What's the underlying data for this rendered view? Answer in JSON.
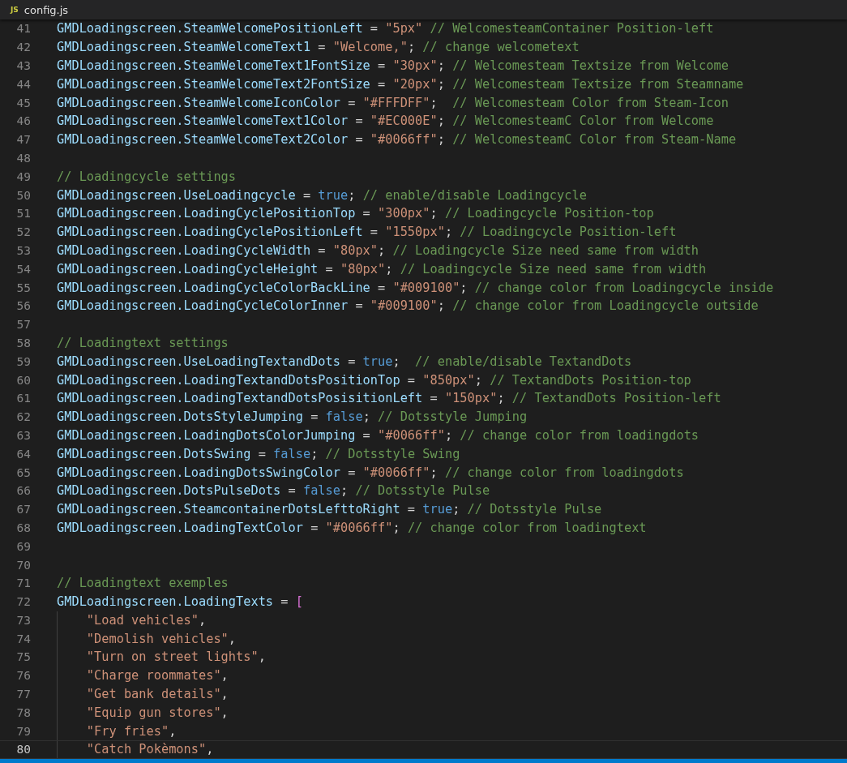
{
  "tab": {
    "icon_text": "JS",
    "title": "config.js"
  },
  "lines": [
    {
      "number": "41",
      "current": false,
      "indent": false,
      "tokens": [
        {
          "kind": "id",
          "text": "GMDLoadingscreen.SteamWelcomePositionLeft"
        },
        {
          "kind": "op",
          "text": " = "
        },
        {
          "kind": "str",
          "text": "\"5px\""
        },
        {
          "kind": "cm",
          "text": " // WelcomesteamContainer Position-left"
        }
      ]
    },
    {
      "number": "42",
      "current": false,
      "indent": false,
      "tokens": [
        {
          "kind": "id",
          "text": "GMDLoadingscreen.SteamWelcomeText1"
        },
        {
          "kind": "op",
          "text": " = "
        },
        {
          "kind": "str",
          "text": "\"Welcome,\""
        },
        {
          "kind": "op",
          "text": "; "
        },
        {
          "kind": "cm",
          "text": "// change welcometext"
        }
      ]
    },
    {
      "number": "43",
      "current": false,
      "indent": false,
      "tokens": [
        {
          "kind": "id",
          "text": "GMDLoadingscreen.SteamWelcomeText1FontSize"
        },
        {
          "kind": "op",
          "text": " = "
        },
        {
          "kind": "str",
          "text": "\"30px\""
        },
        {
          "kind": "op",
          "text": "; "
        },
        {
          "kind": "cm",
          "text": "// Welcomesteam Textsize from Welcome"
        }
      ]
    },
    {
      "number": "44",
      "current": false,
      "indent": false,
      "tokens": [
        {
          "kind": "id",
          "text": "GMDLoadingscreen.SteamWelcomeText2FontSize"
        },
        {
          "kind": "op",
          "text": " = "
        },
        {
          "kind": "str",
          "text": "\"20px\""
        },
        {
          "kind": "op",
          "text": "; "
        },
        {
          "kind": "cm",
          "text": "// Welcomesteam Textsize from Steamname"
        }
      ]
    },
    {
      "number": "45",
      "current": false,
      "indent": false,
      "tokens": [
        {
          "kind": "id",
          "text": "GMDLoadingscreen.SteamWelcomeIconColor"
        },
        {
          "kind": "op",
          "text": " = "
        },
        {
          "kind": "str",
          "text": "\"#FFFDFF\""
        },
        {
          "kind": "op",
          "text": ";  "
        },
        {
          "kind": "cm",
          "text": "// Welcomesteam Color from Steam-Icon"
        }
      ]
    },
    {
      "number": "46",
      "current": false,
      "indent": false,
      "tokens": [
        {
          "kind": "id",
          "text": "GMDLoadingscreen.SteamWelcomeText1Color"
        },
        {
          "kind": "op",
          "text": " = "
        },
        {
          "kind": "str",
          "text": "\"#EC000E\""
        },
        {
          "kind": "op",
          "text": "; "
        },
        {
          "kind": "cm",
          "text": "// WelcomesteamC Color from Welcome"
        }
      ]
    },
    {
      "number": "47",
      "current": false,
      "indent": false,
      "tokens": [
        {
          "kind": "id",
          "text": "GMDLoadingscreen.SteamWelcomeText2Color"
        },
        {
          "kind": "op",
          "text": " = "
        },
        {
          "kind": "str",
          "text": "\"#0066ff\""
        },
        {
          "kind": "op",
          "text": "; "
        },
        {
          "kind": "cm",
          "text": "// WelcomesteamC Color from Steam-Name"
        }
      ]
    },
    {
      "number": "48",
      "current": false,
      "indent": false
    },
    {
      "number": "49",
      "current": false,
      "indent": false,
      "tokens": [
        {
          "kind": "cm",
          "text": "// Loadingcycle settings"
        }
      ]
    },
    {
      "number": "50",
      "current": false,
      "indent": false,
      "tokens": [
        {
          "kind": "id",
          "text": "GMDLoadingscreen.UseLoadingcycle"
        },
        {
          "kind": "op",
          "text": " = "
        },
        {
          "kind": "kw",
          "text": "true"
        },
        {
          "kind": "op",
          "text": "; "
        },
        {
          "kind": "cm",
          "text": "// enable/disable Loadingcycle"
        }
      ]
    },
    {
      "number": "51",
      "current": false,
      "indent": false,
      "tokens": [
        {
          "kind": "id",
          "text": "GMDLoadingscreen.LoadingCyclePositionTop"
        },
        {
          "kind": "op",
          "text": " = "
        },
        {
          "kind": "str",
          "text": "\"300px\""
        },
        {
          "kind": "op",
          "text": "; "
        },
        {
          "kind": "cm",
          "text": "// Loadingcycle Position-top"
        }
      ]
    },
    {
      "number": "52",
      "current": false,
      "indent": false,
      "tokens": [
        {
          "kind": "id",
          "text": "GMDLoadingscreen.LoadingCyclePositionLeft"
        },
        {
          "kind": "op",
          "text": " = "
        },
        {
          "kind": "str",
          "text": "\"1550px\""
        },
        {
          "kind": "op",
          "text": "; "
        },
        {
          "kind": "cm",
          "text": "// Loadingcycle Position-left"
        }
      ]
    },
    {
      "number": "53",
      "current": false,
      "indent": false,
      "tokens": [
        {
          "kind": "id",
          "text": "GMDLoadingscreen.LoadingCycleWidth"
        },
        {
          "kind": "op",
          "text": " = "
        },
        {
          "kind": "str",
          "text": "\"80px\""
        },
        {
          "kind": "op",
          "text": "; "
        },
        {
          "kind": "cm",
          "text": "// Loadingcycle Size need same from width"
        }
      ]
    },
    {
      "number": "54",
      "current": false,
      "indent": false,
      "tokens": [
        {
          "kind": "id",
          "text": "GMDLoadingscreen.LoadingCycleHeight"
        },
        {
          "kind": "op",
          "text": " = "
        },
        {
          "kind": "str",
          "text": "\"80px\""
        },
        {
          "kind": "op",
          "text": "; "
        },
        {
          "kind": "cm",
          "text": "// Loadingcycle Size need same from width"
        }
      ]
    },
    {
      "number": "55",
      "current": false,
      "indent": false,
      "tokens": [
        {
          "kind": "id",
          "text": "GMDLoadingscreen.LoadingCycleColorBackLine"
        },
        {
          "kind": "op",
          "text": " = "
        },
        {
          "kind": "str",
          "text": "\"#009100\""
        },
        {
          "kind": "op",
          "text": "; "
        },
        {
          "kind": "cm",
          "text": "// change color from Loadingcycle inside"
        }
      ]
    },
    {
      "number": "56",
      "current": false,
      "indent": false,
      "tokens": [
        {
          "kind": "id",
          "text": "GMDLoadingscreen.LoadingCycleColorInner"
        },
        {
          "kind": "op",
          "text": " = "
        },
        {
          "kind": "str",
          "text": "\"#009100\""
        },
        {
          "kind": "op",
          "text": "; "
        },
        {
          "kind": "cm",
          "text": "// change color from Loadingcycle outside"
        }
      ]
    },
    {
      "number": "57",
      "current": false,
      "indent": false
    },
    {
      "number": "58",
      "current": false,
      "indent": false,
      "tokens": [
        {
          "kind": "cm",
          "text": "// Loadingtext settings"
        }
      ]
    },
    {
      "number": "59",
      "current": false,
      "indent": false,
      "tokens": [
        {
          "kind": "id",
          "text": "GMDLoadingscreen.UseLoadingTextandDots"
        },
        {
          "kind": "op",
          "text": " = "
        },
        {
          "kind": "kw",
          "text": "true"
        },
        {
          "kind": "op",
          "text": ";  "
        },
        {
          "kind": "cm",
          "text": "// enable/disable TextandDots"
        }
      ]
    },
    {
      "number": "60",
      "current": false,
      "indent": false,
      "tokens": [
        {
          "kind": "id",
          "text": "GMDLoadingscreen.LoadingTextandDotsPositionTop"
        },
        {
          "kind": "op",
          "text": " = "
        },
        {
          "kind": "str",
          "text": "\"850px\""
        },
        {
          "kind": "op",
          "text": "; "
        },
        {
          "kind": "cm",
          "text": "// TextandDots Position-top"
        }
      ]
    },
    {
      "number": "61",
      "current": false,
      "indent": false,
      "tokens": [
        {
          "kind": "id",
          "text": "GMDLoadingscreen.LoadingTextandDotsPosisitionLeft"
        },
        {
          "kind": "op",
          "text": " = "
        },
        {
          "kind": "str",
          "text": "\"150px\""
        },
        {
          "kind": "op",
          "text": "; "
        },
        {
          "kind": "cm",
          "text": "// TextandDots Position-left"
        }
      ]
    },
    {
      "number": "62",
      "current": false,
      "indent": false,
      "tokens": [
        {
          "kind": "id",
          "text": "GMDLoadingscreen.DotsStyleJumping"
        },
        {
          "kind": "op",
          "text": " = "
        },
        {
          "kind": "kw",
          "text": "false"
        },
        {
          "kind": "op",
          "text": "; "
        },
        {
          "kind": "cm",
          "text": "// Dotsstyle Jumping"
        }
      ]
    },
    {
      "number": "63",
      "current": false,
      "indent": false,
      "tokens": [
        {
          "kind": "id",
          "text": "GMDLoadingscreen.LoadingDotsColorJumping"
        },
        {
          "kind": "op",
          "text": " = "
        },
        {
          "kind": "str",
          "text": "\"#0066ff\""
        },
        {
          "kind": "op",
          "text": "; "
        },
        {
          "kind": "cm",
          "text": "// change color from loadingdots"
        }
      ]
    },
    {
      "number": "64",
      "current": false,
      "indent": false,
      "tokens": [
        {
          "kind": "id",
          "text": "GMDLoadingscreen.DotsSwing"
        },
        {
          "kind": "op",
          "text": " = "
        },
        {
          "kind": "kw",
          "text": "false"
        },
        {
          "kind": "op",
          "text": "; "
        },
        {
          "kind": "cm",
          "text": "// Dotsstyle Swing"
        }
      ]
    },
    {
      "number": "65",
      "current": false,
      "indent": false,
      "tokens": [
        {
          "kind": "id",
          "text": "GMDLoadingscreen.LoadingDotsSwingColor"
        },
        {
          "kind": "op",
          "text": " = "
        },
        {
          "kind": "str",
          "text": "\"#0066ff\""
        },
        {
          "kind": "op",
          "text": "; "
        },
        {
          "kind": "cm",
          "text": "// change color from loadingdots"
        }
      ]
    },
    {
      "number": "66",
      "current": false,
      "indent": false,
      "tokens": [
        {
          "kind": "id",
          "text": "GMDLoadingscreen.DotsPulseDots"
        },
        {
          "kind": "op",
          "text": " = "
        },
        {
          "kind": "kw",
          "text": "false"
        },
        {
          "kind": "op",
          "text": "; "
        },
        {
          "kind": "cm",
          "text": "// Dotsstyle Pulse"
        }
      ]
    },
    {
      "number": "67",
      "current": false,
      "indent": false,
      "tokens": [
        {
          "kind": "id",
          "text": "GMDLoadingscreen.SteamcontainerDotsLefttoRight"
        },
        {
          "kind": "op",
          "text": " = "
        },
        {
          "kind": "kw",
          "text": "true"
        },
        {
          "kind": "op",
          "text": "; "
        },
        {
          "kind": "cm",
          "text": "// Dotsstyle Pulse"
        }
      ]
    },
    {
      "number": "68",
      "current": false,
      "indent": false,
      "tokens": [
        {
          "kind": "id",
          "text": "GMDLoadingscreen.LoadingTextColor"
        },
        {
          "kind": "op",
          "text": " = "
        },
        {
          "kind": "str",
          "text": "\"#0066ff\""
        },
        {
          "kind": "op",
          "text": "; "
        },
        {
          "kind": "cm",
          "text": "// change color from loadingtext"
        }
      ]
    },
    {
      "number": "69",
      "current": false,
      "indent": false
    },
    {
      "number": "70",
      "current": false,
      "indent": false
    },
    {
      "number": "71",
      "current": false,
      "indent": false,
      "tokens": [
        {
          "kind": "cm",
          "text": "// Loadingtext exemples"
        }
      ]
    },
    {
      "number": "72",
      "current": false,
      "indent": false,
      "tokens": [
        {
          "kind": "id",
          "text": "GMDLoadingscreen.LoadingTexts"
        },
        {
          "kind": "op",
          "text": " = "
        },
        {
          "kind": "br",
          "text": "["
        }
      ]
    },
    {
      "number": "73",
      "current": false,
      "indent": true,
      "tokens": [
        {
          "kind": "str",
          "text": "\"Load vehicles\""
        },
        {
          "kind": "op",
          "text": ","
        }
      ]
    },
    {
      "number": "74",
      "current": false,
      "indent": true,
      "tokens": [
        {
          "kind": "str",
          "text": "\"Demolish vehicles\""
        },
        {
          "kind": "op",
          "text": ","
        }
      ]
    },
    {
      "number": "75",
      "current": false,
      "indent": true,
      "tokens": [
        {
          "kind": "str",
          "text": "\"Turn on street lights\""
        },
        {
          "kind": "op",
          "text": ","
        }
      ]
    },
    {
      "number": "76",
      "current": false,
      "indent": true,
      "tokens": [
        {
          "kind": "str",
          "text": "\"Charge roommates\""
        },
        {
          "kind": "op",
          "text": ","
        }
      ]
    },
    {
      "number": "77",
      "current": false,
      "indent": true,
      "tokens": [
        {
          "kind": "str",
          "text": "\"Get bank details\""
        },
        {
          "kind": "op",
          "text": ","
        }
      ]
    },
    {
      "number": "78",
      "current": false,
      "indent": true,
      "tokens": [
        {
          "kind": "str",
          "text": "\"Equip gun stores\""
        },
        {
          "kind": "op",
          "text": ","
        }
      ]
    },
    {
      "number": "79",
      "current": false,
      "indent": true,
      "tokens": [
        {
          "kind": "str",
          "text": "\"Fry fries\""
        },
        {
          "kind": "op",
          "text": ","
        }
      ]
    },
    {
      "number": "80",
      "current": true,
      "indent": true,
      "tokens": [
        {
          "kind": "str",
          "text": "\"Catch Pokèmons\""
        },
        {
          "kind": "op",
          "text": ","
        }
      ]
    }
  ]
}
